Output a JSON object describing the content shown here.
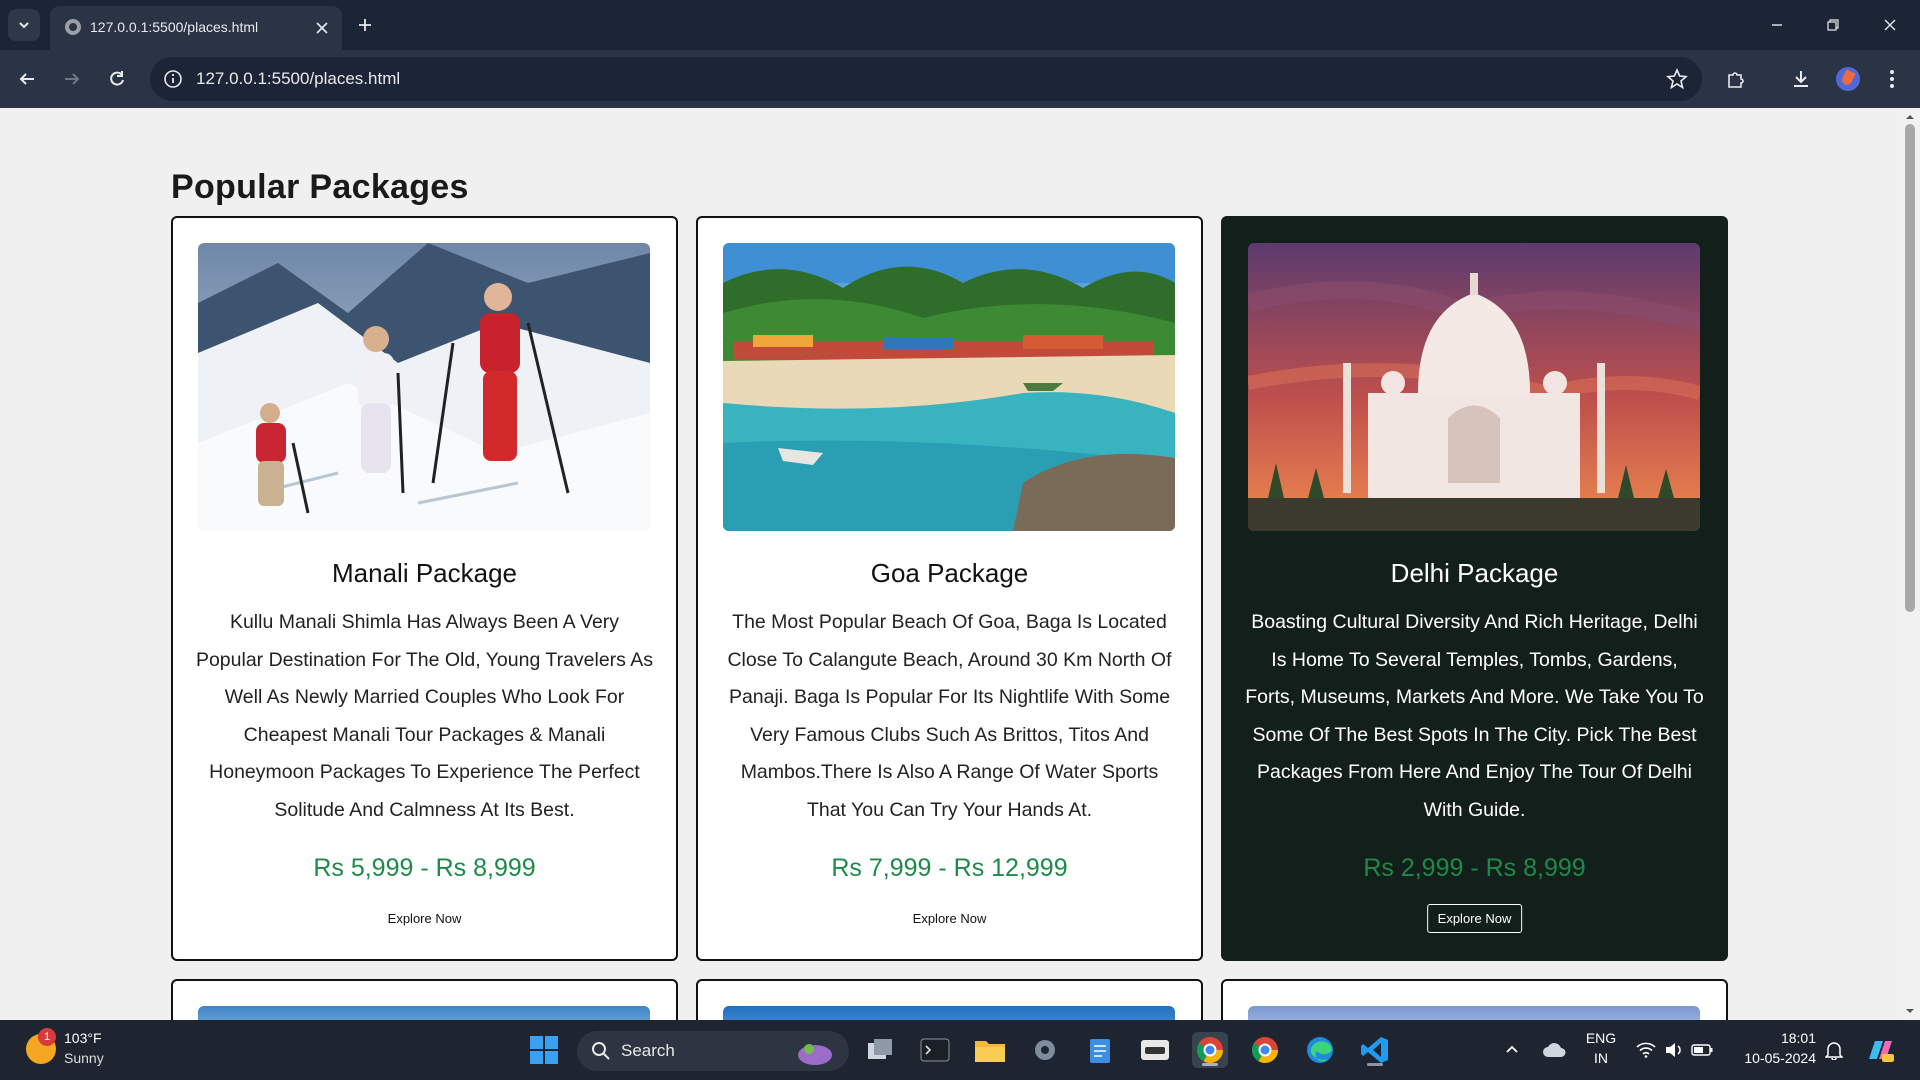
{
  "browser": {
    "tab_title": "127.0.0.1:5500/places.html",
    "url": "127.0.0.1:5500/places.html"
  },
  "page": {
    "heading": "Popular Packages",
    "packages": [
      {
        "title": "Manali Package",
        "description": "Kullu Manali Shimla Has Always Been A Very Popular Destination For The Old, Young Travelers As Well As Newly Married Couples Who Look For Cheapest Manali Tour Packages & Manali Honeymoon Packages To Experience The Perfect Solitude And Calmness At Its Best.",
        "price": "Rs 5,999 - Rs 8,999",
        "cta": "Explore Now",
        "image": "snow-mountain-hikers-photo"
      },
      {
        "title": "Goa Package",
        "description": "The Most Popular Beach Of Goa, Baga Is Located Close To Calangute Beach, Around 30 Km North Of Panaji. Baga Is Popular For Its Nightlife With Some Very Famous Clubs Such As Brittos, Titos And Mambos.There Is Also A Range Of Water Sports That You Can Try Your Hands At.",
        "price": "Rs 7,999 - Rs 12,999",
        "cta": "Explore Now",
        "image": "goa-beach-photo"
      },
      {
        "title": "Delhi Package",
        "description": "Boasting Cultural Diversity And Rich Heritage, Delhi Is Home To Several Temples, Tombs, Gardens, Forts, Museums, Markets And More. We Take You To Some Of The Best Spots In The City. Pick The Best Packages From Here And Enjoy The Tour Of Delhi With Guide.",
        "price": "Rs 2,999 - Rs 8,999",
        "cta": "Explore Now",
        "image": "taj-mahal-photo"
      }
    ]
  },
  "taskbar": {
    "weather_badge": "1",
    "temperature": "103°F",
    "condition": "Sunny",
    "search_label": "Search",
    "lang_top": "ENG",
    "lang_bottom": "IN",
    "time": "18:01",
    "date": "10-05-2024"
  },
  "colors": {
    "accent_price": "#1e8a49",
    "dark_card": "#131f1a",
    "chrome_bg": "#1c2535"
  }
}
